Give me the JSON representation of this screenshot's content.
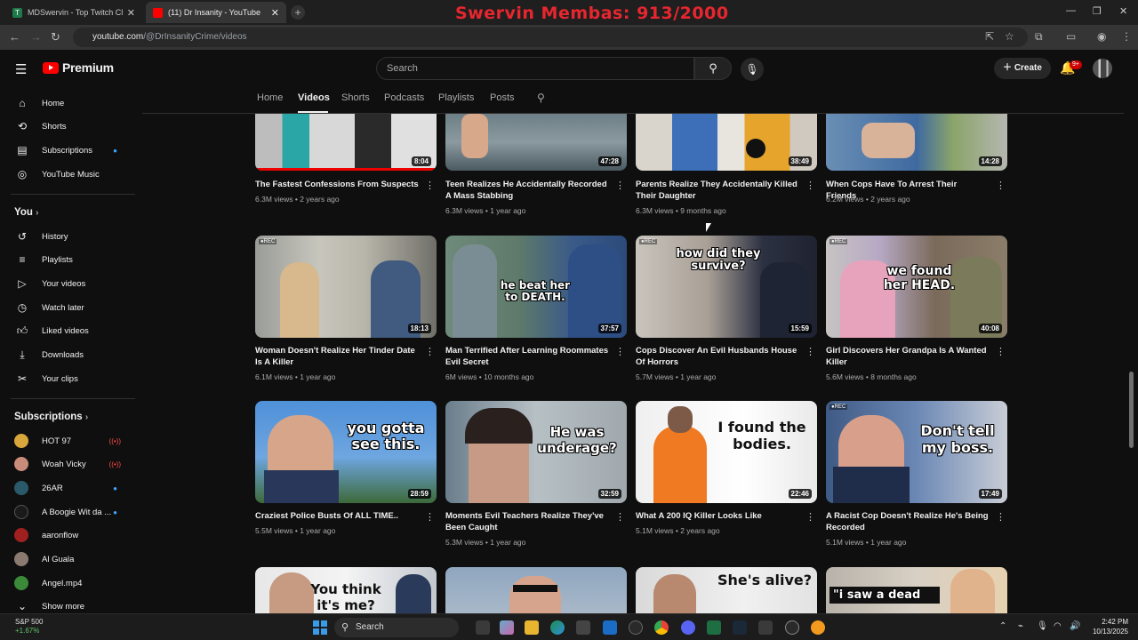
{
  "browser": {
    "tabs": [
      {
        "title": "MDSwervin - Top Twitch Cl",
        "active": false
      },
      {
        "title": "(11) Dr Insanity - YouTube",
        "active": true
      }
    ],
    "url_site": "youtube.com",
    "url_path": "/@DrInsanityCrime/videos",
    "overlay_text": "Swervin Membas: 913/2000"
  },
  "header": {
    "logo_text": "Premium",
    "search_placeholder": "Search",
    "create_label": "Create",
    "notif_badge": "9+"
  },
  "channel_tabs": [
    {
      "label": "Home",
      "active": false
    },
    {
      "label": "Videos",
      "active": true
    },
    {
      "label": "Shorts",
      "active": false
    },
    {
      "label": "Podcasts",
      "active": false
    },
    {
      "label": "Playlists",
      "active": false
    },
    {
      "label": "Posts",
      "active": false
    }
  ],
  "sidebar": {
    "main": [
      {
        "label": "Home",
        "icon": "home-icon"
      },
      {
        "label": "Shorts",
        "icon": "shorts-icon"
      },
      {
        "label": "Subscriptions",
        "icon": "subscriptions-icon"
      },
      {
        "label": "YouTube Music",
        "icon": "youtube-music-icon"
      }
    ],
    "you_heading": "You",
    "you_items": [
      {
        "label": "History",
        "icon": "history-icon"
      },
      {
        "label": "Playlists",
        "icon": "playlists-icon"
      },
      {
        "label": "Your videos",
        "icon": "your-videos-icon"
      },
      {
        "label": "Watch later",
        "icon": "watch-later-icon"
      },
      {
        "label": "Liked videos",
        "icon": "liked-videos-icon"
      },
      {
        "label": "Downloads",
        "icon": "downloads-icon"
      },
      {
        "label": "Your clips",
        "icon": "clips-icon"
      }
    ],
    "subs_heading": "Subscriptions",
    "subscriptions": [
      {
        "label": "HOT 97",
        "status": "live",
        "color": "#d8a63a"
      },
      {
        "label": "Woah Vicky",
        "status": "live",
        "color": "#c98c7a"
      },
      {
        "label": "26AR",
        "status": "new",
        "color": "#2a5a6a"
      },
      {
        "label": "A Boogie Wit da ...",
        "status": "new",
        "color": "#1a1a1a"
      },
      {
        "label": "aaronflow",
        "status": "",
        "color": "#a02020"
      },
      {
        "label": "Al Guala",
        "status": "",
        "color": "#8a7a70"
      },
      {
        "label": "Angel.mp4",
        "status": "",
        "color": "#3a8a3a"
      }
    ],
    "show_more": "Show more"
  },
  "videos": [
    {
      "title": "The Fastest Confessions From Suspects",
      "views": "6.3M views",
      "age": "2 years ago",
      "duration": "8:04",
      "overlay": ""
    },
    {
      "title": "Teen Realizes He Accidentally Recorded A Mass Stabbing",
      "views": "6.3M views",
      "age": "1 year ago",
      "duration": "47:28",
      "overlay": ""
    },
    {
      "title": "Parents Realize They Accidentally Killed Their Daughter",
      "views": "6.3M views",
      "age": "9 months ago",
      "duration": "38:49",
      "overlay": ""
    },
    {
      "title": "When Cops Have To Arrest Their Friends",
      "views": "6.2M views",
      "age": "2 years ago",
      "duration": "14:28",
      "overlay": ""
    },
    {
      "title": "Woman Doesn't Realize Her Tinder Date Is A Killer",
      "views": "6.1M views",
      "age": "1 year ago",
      "duration": "18:13",
      "overlay": ""
    },
    {
      "title": "Man Terrified After Learning Roommates Evil Secret",
      "views": "6M views",
      "age": "10 months ago",
      "duration": "37:57",
      "overlay": "he beat her to DEATH."
    },
    {
      "title": "Cops Discover An Evil Husbands House Of Horrors",
      "views": "5.7M views",
      "age": "1 year ago",
      "duration": "15:59",
      "overlay": "how did they survive?"
    },
    {
      "title": "Girl Discovers Her Grandpa Is A Wanted Killer",
      "views": "5.6M views",
      "age": "8 months ago",
      "duration": "40:08",
      "overlay": "we found her HEAD."
    },
    {
      "title": "Craziest Police Busts Of ALL TIME..",
      "views": "5.5M views",
      "age": "1 year ago",
      "duration": "28:59",
      "overlay": "you gotta see this."
    },
    {
      "title": "Moments Evil Teachers Realize They've Been Caught",
      "views": "5.3M views",
      "age": "1 year ago",
      "duration": "32:59",
      "overlay": "He was underage?"
    },
    {
      "title": "What A 200 IQ Killer Looks Like",
      "views": "5.1M views",
      "age": "2 years ago",
      "duration": "22:46",
      "overlay": "I found the bodies."
    },
    {
      "title": "A Racist Cop Doesn't Realize He's Being Recorded",
      "views": "5.1M views",
      "age": "1 year ago",
      "duration": "17:49",
      "overlay": "Don't tell my boss."
    },
    {
      "title": "",
      "views": "",
      "age": "",
      "duration": "",
      "overlay": "You think it's me?"
    },
    {
      "title": "",
      "views": "",
      "age": "",
      "duration": "",
      "overlay": ""
    },
    {
      "title": "",
      "views": "",
      "age": "",
      "duration": "",
      "overlay": "She's alive?"
    },
    {
      "title": "",
      "views": "",
      "age": "",
      "duration": "",
      "overlay": "\"i saw a dead"
    }
  ],
  "taskbar": {
    "stock_name": "S&P 500",
    "stock_change": "+1.67%",
    "search_label": "Search",
    "time": "2:42 PM",
    "date": "10/13/2025"
  }
}
